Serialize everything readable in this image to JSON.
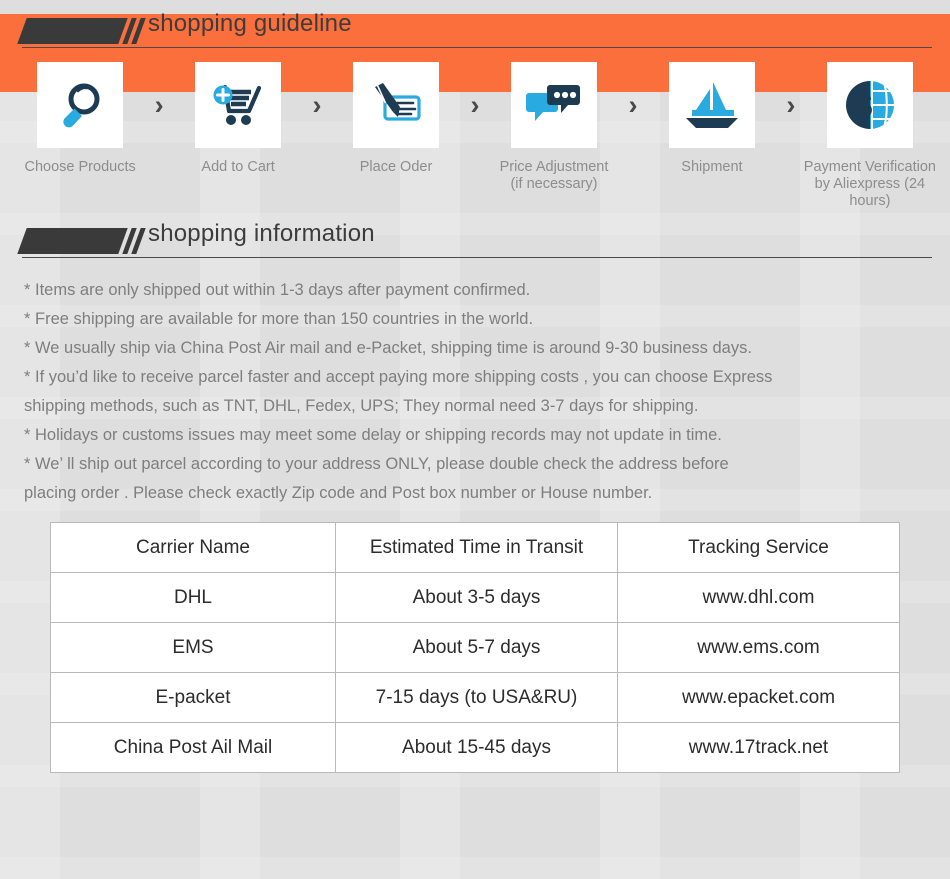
{
  "theme": {
    "banner_color": "#fb6f3c",
    "page_background": "#dedede",
    "heading_color": "#3c3c3c",
    "caption_color": "#8d8d8d",
    "body_text_color": "#7e7e7e",
    "icon_dark": "#1d3b53",
    "icon_blue": "#29abe2"
  },
  "guideline": {
    "heading": "shopping guideline",
    "steps": [
      {
        "icon": "magnifier-icon",
        "label": "Choose Products"
      },
      {
        "icon": "add-to-cart-icon",
        "label": "Add to Cart"
      },
      {
        "icon": "pen-cheque-icon",
        "label": "Place Oder"
      },
      {
        "icon": "chat-bubbles-icon",
        "label": "Price Adjustment\n(if necessary)"
      },
      {
        "icon": "sailboat-icon",
        "label": "Shipment"
      },
      {
        "icon": "dollar-globe-icon",
        "label": "Payment Verification\nby  Aliexpress (24 hours)"
      }
    ],
    "separator": "›"
  },
  "information": {
    "heading": "shopping information",
    "bullets": [
      "* Items are only shipped out within 1-3 days after payment confirmed.",
      "* Free shipping are available for more than 150 countries in the world.",
      "* We usually ship via China Post Air mail and e-Packet, shipping time is around 9-30 business days.",
      "* If you’d like to receive parcel faster and accept paying more shipping costs , you can choose Express\n   shipping methods, such as TNT, DHL, Fedex, UPS; They normal need 3-7 days for shipping.",
      "* Holidays or customs issues may meet some delay or shipping records may not update in time.",
      "* We’ ll ship out parcel according to your address ONLY, please double check the address before\n   placing order . Please check exactly Zip code and Post box number or House number."
    ]
  },
  "carrier_table": {
    "headers": [
      "Carrier Name",
      "Estimated Time in Transit",
      "Tracking Service"
    ],
    "rows": [
      [
        "DHL",
        "About 3-5 days",
        "www.dhl.com"
      ],
      [
        "EMS",
        "About 5-7 days",
        "www.ems.com"
      ],
      [
        "E-packet",
        "7-15 days (to USA&RU)",
        "www.epacket.com"
      ],
      [
        "China Post Ail Mail",
        "About 15-45 days",
        "www.17track.net"
      ]
    ]
  }
}
